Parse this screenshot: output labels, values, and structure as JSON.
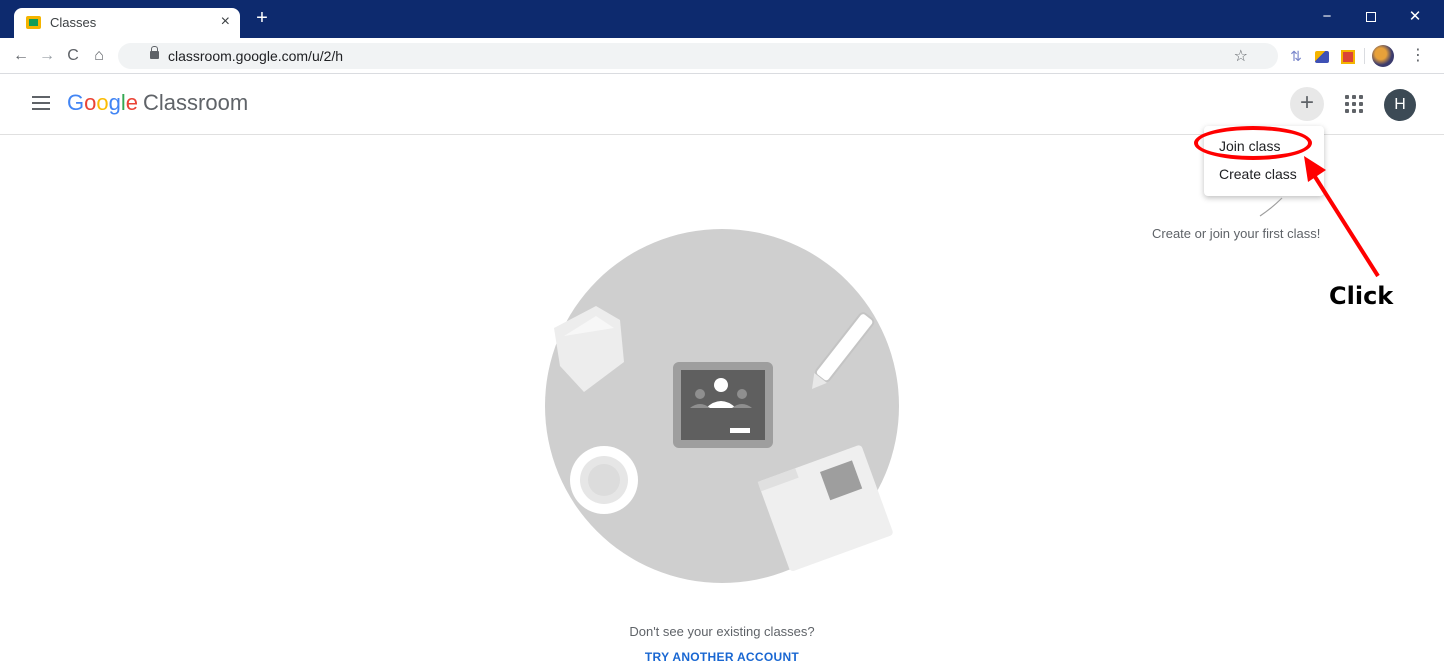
{
  "browser": {
    "tab": {
      "title": "Classes",
      "close_glyph": "×"
    },
    "new_tab_glyph": "+",
    "window_controls": {
      "minimize": "−",
      "close": "✕"
    },
    "nav": {
      "back": "←",
      "forward": "→",
      "reload": "C",
      "home": "⌂"
    },
    "url": "classroom.google.com/u/2/h",
    "star_glyph": "☆",
    "kebab_glyph": "⋮",
    "extension_glyph": "⇅"
  },
  "header": {
    "logo_letters": [
      "G",
      "o",
      "o",
      "g",
      "l",
      "e"
    ],
    "product": "Classroom",
    "plus_glyph": "+",
    "avatar_initial": "H"
  },
  "menu": {
    "items": [
      {
        "label": "Join class"
      },
      {
        "label": "Create class"
      }
    ]
  },
  "hint": {
    "text": "Create or join your first class!"
  },
  "annotation": {
    "label": "Click",
    "color": "#ff0000"
  },
  "footer": {
    "question": "Don't see your existing classes?",
    "link": "TRY ANOTHER ACCOUNT"
  },
  "colors": {
    "tabstrip": "#0d2a6e",
    "brand_blue": "#4285f4",
    "brand_red": "#ea4335",
    "brand_yellow": "#fbbc05",
    "brand_green": "#34a853",
    "link": "#1967d2"
  }
}
